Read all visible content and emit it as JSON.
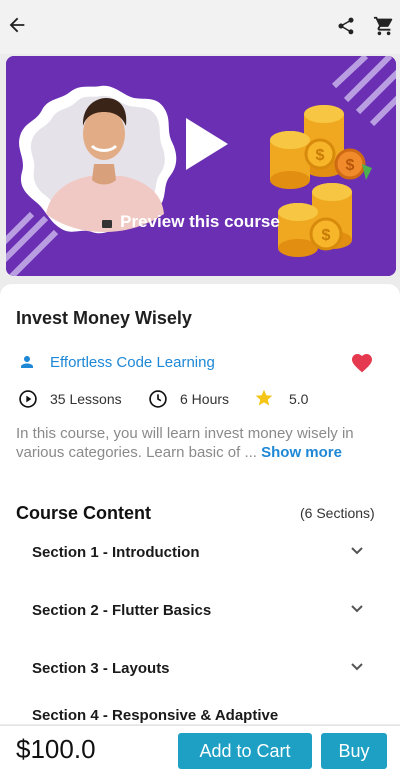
{
  "preview": {
    "label": "Preview this course"
  },
  "course": {
    "title": "Invest Money Wisely",
    "author": "Effortless Code Learning",
    "lessons": "35 Lessons",
    "duration": "6 Hours",
    "rating": "5.0",
    "description": "In this course, you will learn invest money wisely in various categories. Learn basic of ...",
    "show_more": "Show more"
  },
  "content": {
    "title": "Course Content",
    "count": "(6 Sections)",
    "sections": [
      {
        "label": "Section 1 - Introduction"
      },
      {
        "label": "Section 2 - Flutter Basics"
      },
      {
        "label": "Section 3 - Layouts"
      },
      {
        "label": "Section 4 - Responsive & Adaptive"
      }
    ]
  },
  "purchase": {
    "price": "$100.0",
    "add_to_cart": "Add to Cart",
    "buy": "Buy"
  },
  "colors": {
    "accent": "#1da0c3",
    "link": "#1e88d6",
    "banner": "#6a2fb3",
    "heart": "#e53950",
    "star": "#f5c518"
  },
  "icons": [
    "back-arrow-icon",
    "share-icon",
    "cart-icon",
    "play-icon",
    "person-icon",
    "heart-icon",
    "play-circle-icon",
    "clock-icon",
    "star-icon",
    "chevron-down-icon"
  ]
}
